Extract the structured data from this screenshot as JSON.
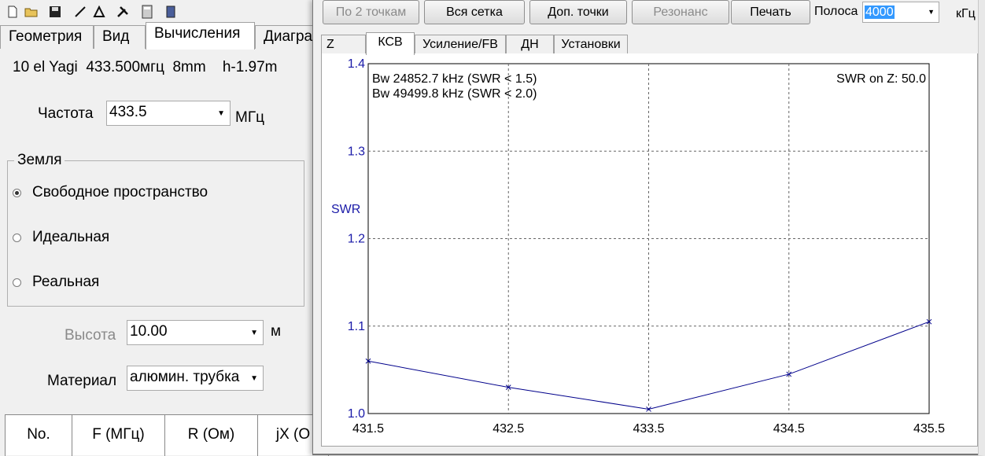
{
  "back": {
    "tabs": [
      "Геометрия",
      "Вид",
      "Вычисления",
      "Диагра"
    ],
    "model": {
      "name": "10 el Yagi",
      "freq": "433.500мгц",
      "wire": "8mm",
      "height": "h-1.97m"
    },
    "freq_label": "Частота",
    "freq_value": "433.5",
    "freq_unit": "МГц",
    "ground_title": "Земля",
    "ground_options": [
      "Свободное пространство",
      "Идеальная",
      "Реальная"
    ],
    "height_label": "Высота",
    "height_value": "10.00",
    "height_unit": "м",
    "material_label": "Материал",
    "material_value": "алюмин. трубка",
    "table_headers": [
      "No.",
      "F (МГц)",
      "R (Ом)",
      "jX (О"
    ]
  },
  "front": {
    "buttons": [
      "По 2 точкам",
      "Вся сетка",
      "Доп. точки",
      "Резонанс",
      "Печать"
    ],
    "band_label": "Полоса",
    "band_value": "4000",
    "band_unit": "кГц",
    "tabs": [
      "Z",
      "КСВ",
      "Усиление/FB",
      "ДН",
      "Установки"
    ],
    "annotations": {
      "bw1": "Bw 24852.7 kHz (SWR < 1.5)",
      "bw2": "Bw 49499.8 kHz (SWR < 2.0)",
      "swr_on_z": "SWR on Z: 50.0"
    }
  },
  "colors": {
    "series": "#00008b",
    "axis_text": "#1a1aa8",
    "selection": "#3399ff"
  },
  "chart_data": {
    "type": "line",
    "ylabel": "SWR",
    "xlabel": "",
    "xlim": [
      431.5,
      435.5
    ],
    "ylim": [
      1.0,
      1.4
    ],
    "x_ticks": [
      "431.5",
      "432.5",
      "433.5",
      "434.5",
      "435.5"
    ],
    "y_ticks": [
      "1.0",
      "1.1",
      "1.2",
      "1.3",
      "1.4"
    ],
    "grid": true,
    "series": [
      {
        "x": [
          431.5,
          432.5,
          433.5,
          434.5,
          435.5
        ],
        "y": [
          1.06,
          1.03,
          1.005,
          1.045,
          1.105
        ]
      }
    ]
  }
}
